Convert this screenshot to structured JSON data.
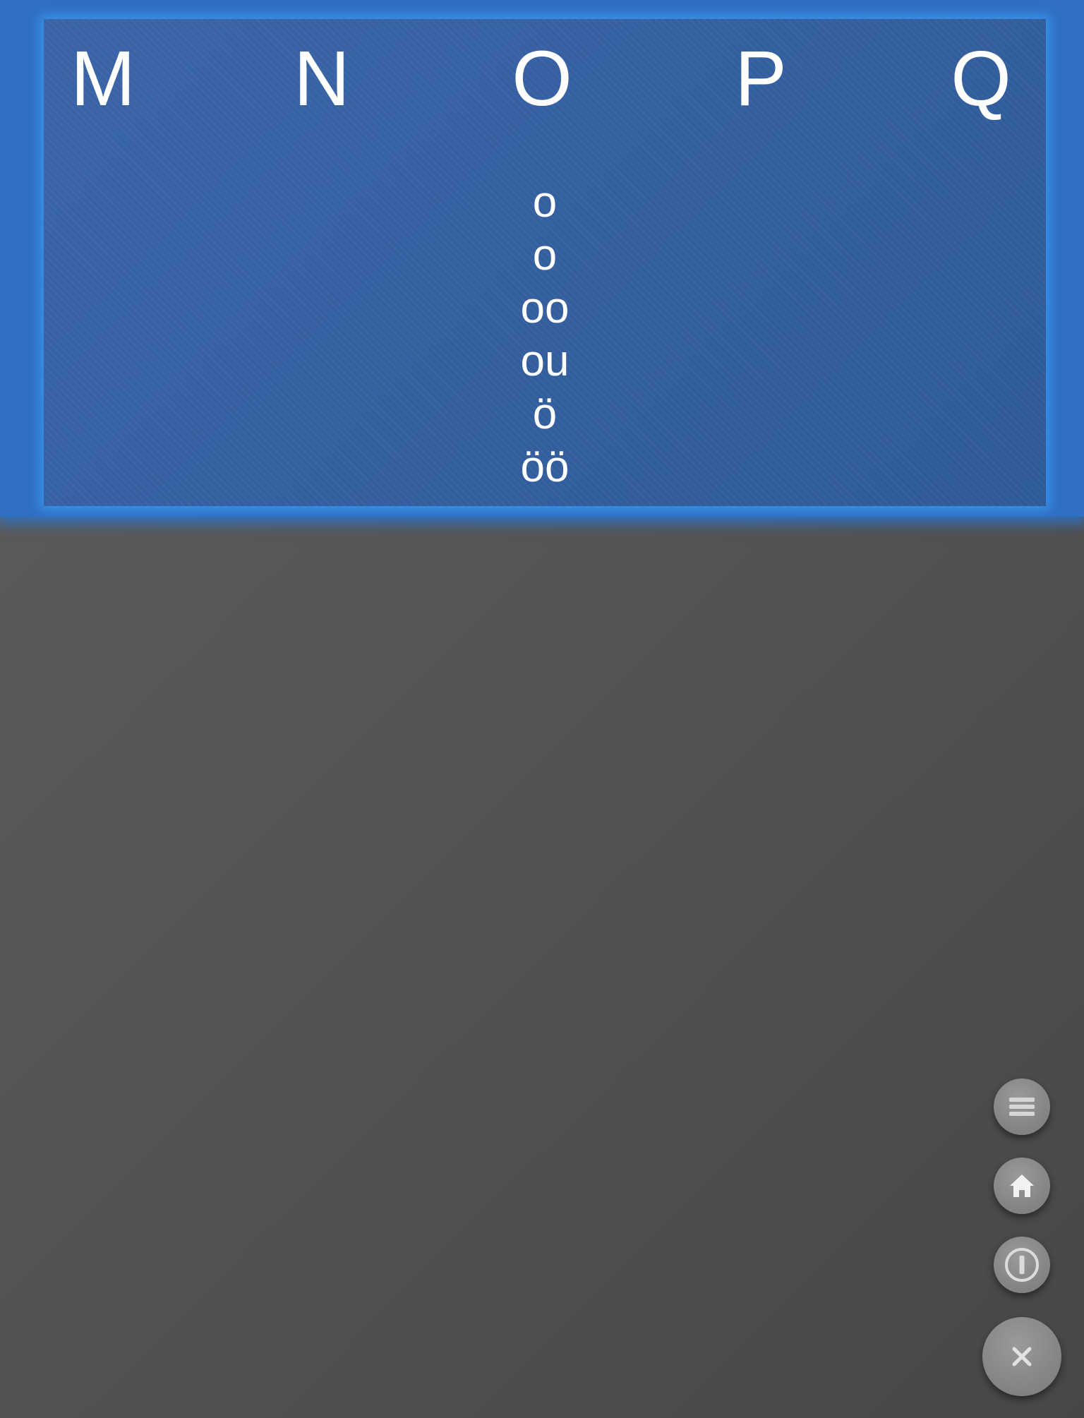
{
  "letters": [
    "M",
    "N",
    "O",
    "P",
    "Q"
  ],
  "selected_letter": "O",
  "spellings": [
    "o",
    "o",
    "oo",
    "ou",
    "ö",
    "öö"
  ],
  "colors": {
    "accent": "#2f6fc4",
    "panel": "#345f9f",
    "background": "#555555",
    "button": "#868686"
  },
  "controls": {
    "menu_icon": "menu-icon",
    "home_icon": "home-icon",
    "info_icon": "info-icon",
    "close_icon": "close-icon"
  }
}
